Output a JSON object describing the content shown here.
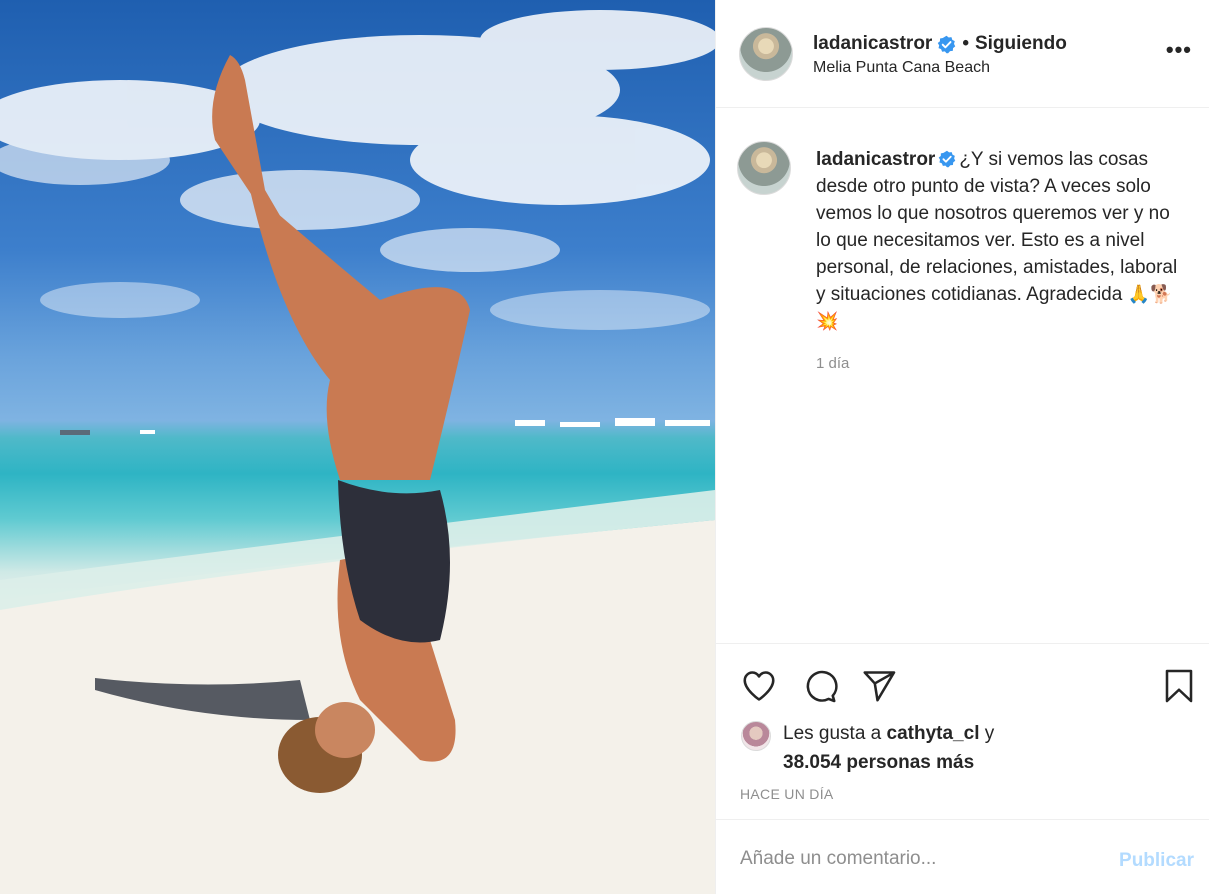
{
  "post": {
    "username": "ladanicastror",
    "separator": "•",
    "follow_status": "Siguiendo",
    "location": "Melia Punta Cana Beach",
    "more_label": "•••"
  },
  "caption": {
    "username": "ladanicastror",
    "text": "¿Y si vemos las cosas desde otro punto de vista? A veces solo vemos lo que nosotros queremos ver y no lo que necesitamos ver. Esto es a nivel personal, de relaciones, amistades, laboral y situaciones cotidianas. Agradecida ",
    "emojis": "🙏🐕💥",
    "time": "1 día"
  },
  "likes": {
    "prefix": "Les gusta a ",
    "liker": "cathyta_cl",
    "suffix": " y",
    "count_text": "38.054 personas más"
  },
  "posted_ago": "HACE UN DÍA",
  "comment": {
    "placeholder": "Añade un comentario...",
    "publish_label": "Publicar"
  },
  "icons": [
    "heart-icon",
    "comment-icon",
    "share-icon",
    "bookmark-icon",
    "verified-badge-icon",
    "more-options-icon"
  ],
  "colors": {
    "verified": "#3897f0",
    "publish_disabled": "#b3dbff",
    "muted_text": "#8e8e8e"
  }
}
